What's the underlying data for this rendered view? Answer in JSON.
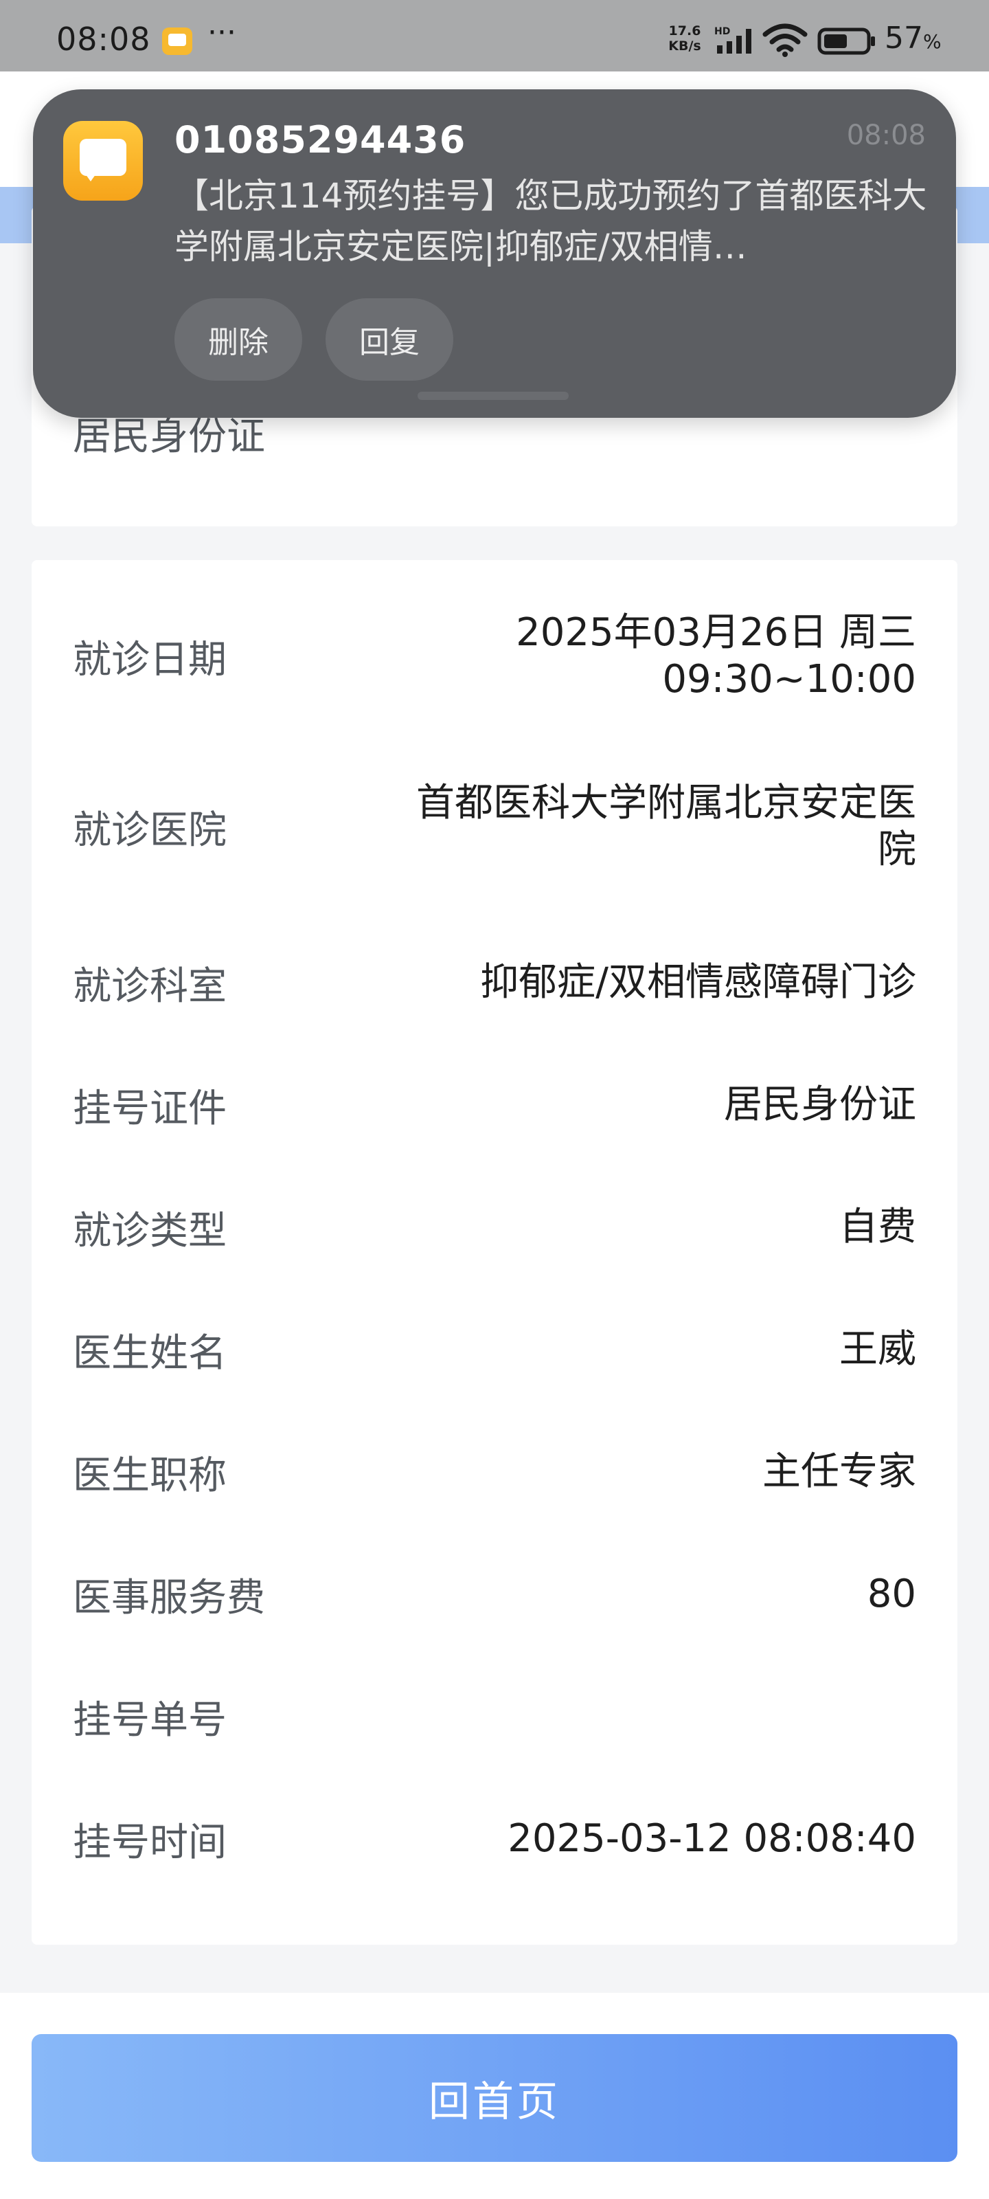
{
  "status_bar": {
    "time": "08:08",
    "more": "···",
    "speed_value": "17.6",
    "speed_unit": "KB/s",
    "network_tag": "HD",
    "battery_percent": "57",
    "battery_sign": "%",
    "battery_level": 0.57
  },
  "notification": {
    "sender": "01085294436",
    "time": "08:08",
    "body": "【北京114预约挂号】您已成功预约了首都医科大学附属北京安定医院|抑郁症/双相情…",
    "delete_label": "删除",
    "reply_label": "回复"
  },
  "id_card": {
    "label": "居民身份证"
  },
  "details": [
    {
      "label": "就诊日期",
      "value": "2025年03月26日 周三 09:30~10:00"
    },
    {
      "label": "就诊医院",
      "value": "首都医科大学附属北京安定医院"
    },
    {
      "label": "就诊科室",
      "value": "抑郁症/双相情感障碍门诊"
    },
    {
      "label": "挂号证件",
      "value": "居民身份证"
    },
    {
      "label": "就诊类型",
      "value": "自费"
    },
    {
      "label": "医生姓名",
      "value": "王威"
    },
    {
      "label": "医生职称",
      "value": "主任专家"
    },
    {
      "label": "医事服务费",
      "value": "80"
    },
    {
      "label": "挂号单号",
      "value": ""
    },
    {
      "label": "挂号时间",
      "value": "2025-03-12 08:08:40"
    }
  ],
  "home_button": {
    "label": "回首页"
  },
  "colors": {
    "accent": "#5b8ff2",
    "notification_bg": "#5c5e62",
    "message_app": "#f6a41a"
  }
}
